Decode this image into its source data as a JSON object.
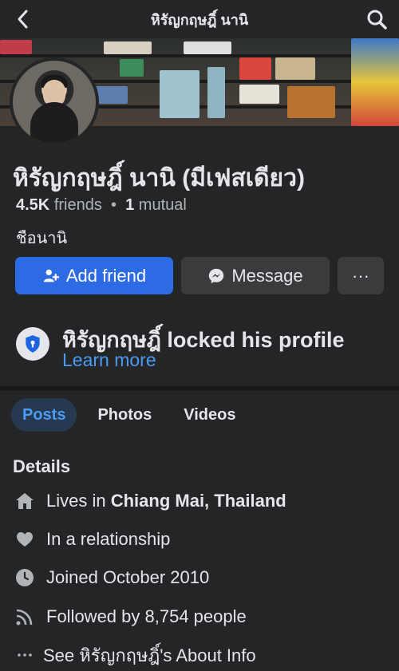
{
  "header": {
    "title": "หิรัญกฤษฎิ์ นานิ",
    "back_icon": "chevron-left-icon",
    "search_icon": "search-icon"
  },
  "profile": {
    "name": "หิรัญกฤษฎิ์ นานิ (มีเฟสเดียว)",
    "friends_count": "4.5K",
    "friends_label": "friends",
    "separator": "•",
    "mutual_count": "1",
    "mutual_label": "mutual",
    "nickname": "ชือนานิ"
  },
  "actions": {
    "add_friend": "Add friend",
    "message": "Message",
    "more": "···"
  },
  "lock": {
    "title": "หิรัญกฤษฎิ์ locked his profile",
    "learn_more": "Learn more"
  },
  "tabs": [
    {
      "label": "Posts",
      "active": true
    },
    {
      "label": "Photos",
      "active": false
    },
    {
      "label": "Videos",
      "active": false
    }
  ],
  "details": {
    "title": "Details",
    "lives_prefix": "Lives in ",
    "lives_place": "Chiang Mai, Thailand",
    "relationship": "In a relationship",
    "joined": "Joined October 2010",
    "followed": "Followed by 8,754 people",
    "about": "See หิรัญกฤษฎิ์'s About Info"
  },
  "colors": {
    "background": "#242526",
    "primary_button": "#2d6be4",
    "link": "#4b9bf5",
    "active_tab_bg": "#263951"
  }
}
